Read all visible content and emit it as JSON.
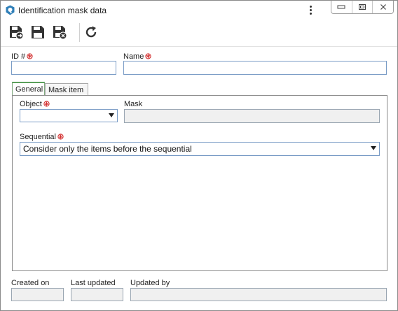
{
  "window": {
    "title": "Identification mask data"
  },
  "icons": {
    "app": "app-logo-icon",
    "menu": "kebab-menu-icon",
    "minimize": "minimize-icon",
    "restore": "restore-icon",
    "close": "close-icon",
    "save_new": "save-and-new-icon",
    "save": "save-icon",
    "save_close": "save-and-close-icon",
    "refresh": "refresh-icon",
    "required": "required-asterisk-icon"
  },
  "form": {
    "id_label": "ID #",
    "id_value": "",
    "name_label": "Name",
    "name_value": ""
  },
  "tabs": [
    {
      "label": "General",
      "active": true
    },
    {
      "label": "Mask item",
      "active": false
    }
  ],
  "general": {
    "object_label": "Object",
    "object_value": "",
    "mask_label": "Mask",
    "mask_value": "",
    "sequential_label": "Sequential",
    "sequential_value": "Consider only the items before the sequential"
  },
  "footer": {
    "created_on_label": "Created on",
    "created_on_value": "",
    "last_updated_label": "Last updated",
    "last_updated_value": "",
    "updated_by_label": "Updated by",
    "updated_by_value": ""
  },
  "colors": {
    "required": "#d32f2f",
    "active_tab": "#5aa05a",
    "input_border": "#7a9cc6"
  }
}
